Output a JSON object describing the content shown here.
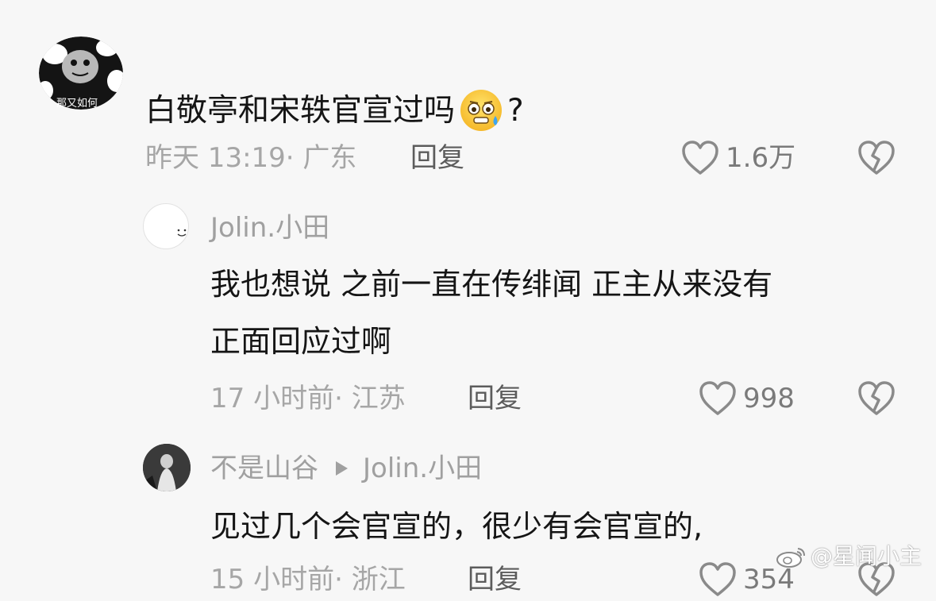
{
  "comments": [
    {
      "avatar_caption": "那又如何",
      "text": "白敬亭和宋轶官宣过吗",
      "emoji": "sweating-face-emoji",
      "text_suffix": "?",
      "time": "昨天 13:19",
      "location": "· 广东",
      "reply_label": "回复",
      "likes": "1.6万"
    },
    {
      "username": "Jolin.小田",
      "text_line1": "我也想说 之前一直在传绯闻 正主从来没有",
      "text_line2": "正面回应过啊",
      "time": "17 小时前",
      "location": "· 江苏",
      "reply_label": "回复",
      "likes": "998"
    },
    {
      "username": "不是山谷",
      "reply_to": "Jolin.小田",
      "text": "见过几个会官宣的，很少有会官宣的,",
      "time": "15 小时前",
      "location": "· 浙江",
      "reply_label": "回复",
      "likes": "354"
    }
  ],
  "watermark": "@星闻小主",
  "icons": {
    "like": "heart-outline-icon",
    "dislike": "broken-heart-icon",
    "reply_arrow": "play-triangle-icon",
    "watermark_logo": "weibo-logo-icon"
  },
  "colors": {
    "background": "#f7f7f7",
    "text": "#151515",
    "meta": "#a6a6a6",
    "icon": "#8a8a8a"
  }
}
